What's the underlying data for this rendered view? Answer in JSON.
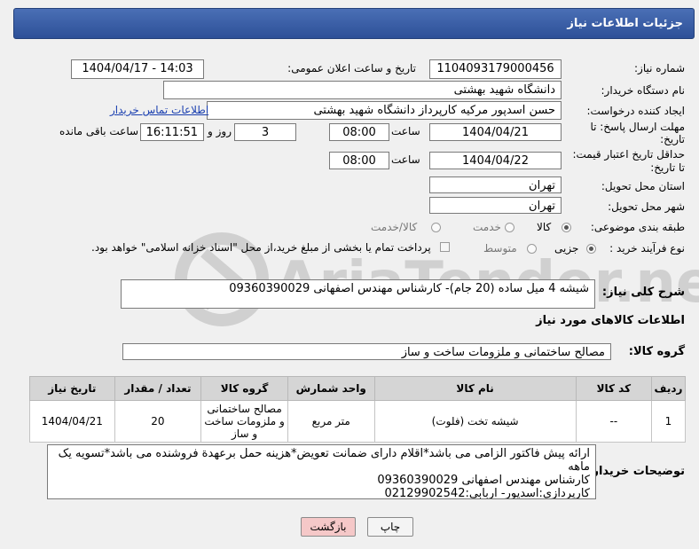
{
  "header": {
    "title": "جزئیات اطلاعات نیاز"
  },
  "form": {
    "need_number_label": "شماره نیاز:",
    "need_number": "1104093179000456",
    "announce_label": "تاریخ و ساعت اعلان عمومی:",
    "announce_value": "1404/04/17 - 14:03",
    "buyer_org_label": "نام دستگاه خریدار:",
    "buyer_org": "دانشگاه شهید بهشتی",
    "creator_label": "ایجاد کننده درخواست:",
    "creator": "حسن اسدپور مرکیه کارپرداز دانشگاه شهید بهشتی",
    "contact_link": "اطلاعات تماس خریدار",
    "deadline_label_1": "مهلت ارسال پاسخ: تا",
    "deadline_label_2": "تاریخ:",
    "deadline_date": "1404/04/21",
    "time_label": "ساعت",
    "deadline_time": "08:00",
    "days_value": "3",
    "days_label": "روز و",
    "remaining_time": "16:11:51",
    "remaining_label": "ساعت باقی مانده",
    "price_label_1": "حداقل تاریخ اعتبار قیمت:",
    "price_label_2": "تا تاریخ:",
    "price_date": "1404/04/22",
    "price_time": "08:00",
    "province_label": "استان محل تحویل:",
    "province": "تهران",
    "city_label": "شهر محل تحویل:",
    "city": "تهران",
    "category_label": "طبقه بندی موضوعی:",
    "category_options": [
      "کالا",
      "خدمت",
      "کالا/خدمت"
    ],
    "process_label": "نوع فرآیند خرید :",
    "process_options": [
      "جزیی",
      "متوسط"
    ],
    "payment_note": "پرداخت تمام یا بخشی از مبلغ خرید،از محل \"اسناد خزانه اسلامی\" خواهد بود.",
    "description_label": "شرح کلی نیاز:",
    "description": "شیشه 4 میل ساده (20 جام)- کارشناس مهندس اصفهانی 09360390029",
    "goods_info_title": "اطلاعات کالاهای مورد نیاز",
    "goods_group_label": "گروه کالا:",
    "goods_group": "مصالح ساختمانی و ملزومات ساخت و ساز"
  },
  "table": {
    "headers": [
      "ردیف",
      "کد کالا",
      "نام کالا",
      "واحد شمارش",
      "گروه کالا",
      "تعداد / مقدار",
      "تاریخ نیاز"
    ],
    "rows": [
      [
        "1",
        "--",
        "شیشه تخت (فلوت)",
        "متر مربع",
        "مصالح ساختمانی و ملزومات ساخت و ساز",
        "20",
        "1404/04/21"
      ]
    ]
  },
  "buyer_notes": {
    "label": "توضیحات خریدار:",
    "line1": "ارائه پیش فاکتور الزامی می باشد*اقلام دارای ضمانت تعویض*هزینه حمل برعهدة فروشنده می باشد*تسویه یک ماهه",
    "line2": "کارشناس مهندس اصفهانی 09360390029",
    "line3": "کارپردازی:اسدپور- اربابی:02129902542"
  },
  "buttons": {
    "print": "چاپ",
    "back": "بازگشت"
  },
  "watermark": {
    "text": "AriaTender.neT"
  },
  "colors": {
    "header": "#2d5098",
    "link": "#1a3fb0",
    "back_button": "#f5c8c8"
  }
}
